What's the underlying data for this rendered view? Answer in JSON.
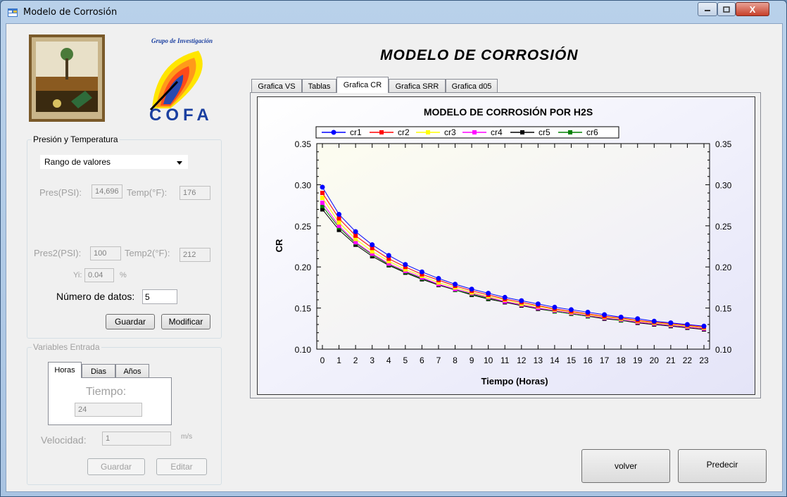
{
  "window": {
    "title": "Modelo de Corrosión",
    "close_glyph": "X"
  },
  "header": {
    "main_title": "MODELO DE CORROSIÓN",
    "logo_right_caption": "Grupo de Investigación",
    "logo_right_name": "COFA"
  },
  "presion_temperatura": {
    "group_title": "Presión y Temperatura",
    "combo_value": "Rango de valores",
    "pres_label": "Pres(PSI):",
    "pres_value": "14,696",
    "temp_label": "Temp(°F):",
    "temp_value": "176",
    "pres2_label": "Pres2(PSI):",
    "pres2_value": "100",
    "temp2_label": "Temp2(°F):",
    "temp2_value": "212",
    "yi_label": "Yi:",
    "yi_value": "0.04",
    "yi_unit": "%",
    "num_datos_label": "Número de datos:",
    "num_datos_value": "5",
    "guardar_label": "Guardar",
    "modificar_label": "Modificar"
  },
  "variables_entrada": {
    "group_title": "Variables Entrada",
    "tabs": [
      "Horas",
      "Dias",
      "Años"
    ],
    "tiempo_label": "Tiempo:",
    "tiempo_value": "24",
    "velocidad_label": "Velocidad:",
    "velocidad_value": "1",
    "velocidad_unit": "m/s",
    "guardar_label": "Guardar",
    "editar_label": "Editar"
  },
  "chart_tabs": [
    "Grafica VS",
    "Tablas",
    "Grafica CR",
    "Grafica SRR",
    "Grafica d05"
  ],
  "chart_tabs_active": "Grafica CR",
  "buttons": {
    "volver": "volver",
    "predecir": "Predecir"
  },
  "chart_data": {
    "type": "line",
    "title": "MODELO DE CORROSIÓN POR H2S",
    "xlabel": "Tiempo (Horas)",
    "ylabel": "CR",
    "x": [
      0,
      1,
      2,
      3,
      4,
      5,
      6,
      7,
      8,
      9,
      10,
      11,
      12,
      13,
      14,
      15,
      16,
      17,
      18,
      19,
      20,
      21,
      22,
      23
    ],
    "xlim": [
      0,
      23
    ],
    "ylim": [
      0.1,
      0.35
    ],
    "yticks": [
      "0.10",
      "0.15",
      "0.20",
      "0.25",
      "0.30",
      "0.35"
    ],
    "legend_position": "top",
    "grid": false,
    "series": [
      {
        "name": "cr1",
        "color": "#0000ff",
        "values": [
          0.297,
          0.264,
          0.243,
          0.227,
          0.214,
          0.203,
          0.194,
          0.186,
          0.179,
          0.173,
          0.168,
          0.163,
          0.159,
          0.155,
          0.151,
          0.148,
          0.145,
          0.142,
          0.139,
          0.137,
          0.134,
          0.132,
          0.13,
          0.128
        ]
      },
      {
        "name": "cr2",
        "color": "#ff0000",
        "values": [
          0.29,
          0.259,
          0.238,
          0.223,
          0.21,
          0.2,
          0.191,
          0.184,
          0.177,
          0.171,
          0.166,
          0.161,
          0.157,
          0.153,
          0.149,
          0.146,
          0.143,
          0.14,
          0.138,
          0.135,
          0.133,
          0.131,
          0.129,
          0.127
        ]
      },
      {
        "name": "cr3",
        "color": "#ffff00",
        "values": [
          0.284,
          0.254,
          0.234,
          0.219,
          0.207,
          0.197,
          0.189,
          0.181,
          0.175,
          0.169,
          0.164,
          0.16,
          0.155,
          0.152,
          0.148,
          0.145,
          0.142,
          0.139,
          0.137,
          0.134,
          0.132,
          0.13,
          0.128,
          0.126
        ]
      },
      {
        "name": "cr4",
        "color": "#ff00ff",
        "values": [
          0.278,
          0.25,
          0.23,
          0.216,
          0.204,
          0.195,
          0.187,
          0.179,
          0.173,
          0.168,
          0.163,
          0.158,
          0.154,
          0.15,
          0.147,
          0.144,
          0.141,
          0.138,
          0.136,
          0.133,
          0.131,
          0.129,
          0.127,
          0.125
        ]
      },
      {
        "name": "cr5",
        "color": "#000000",
        "values": [
          0.27,
          0.245,
          0.227,
          0.213,
          0.202,
          0.193,
          0.185,
          0.178,
          0.172,
          0.166,
          0.161,
          0.157,
          0.153,
          0.149,
          0.146,
          0.143,
          0.14,
          0.137,
          0.135,
          0.132,
          0.13,
          0.128,
          0.126,
          0.124
        ]
      },
      {
        "name": "cr6",
        "color": "#008000",
        "values": [
          0.274,
          0.248,
          0.229,
          0.215,
          0.203,
          0.194,
          0.186,
          0.179,
          0.172,
          0.167,
          0.162,
          0.158,
          0.154,
          0.15,
          0.146,
          0.143,
          0.14,
          0.138,
          0.135,
          0.133,
          0.131,
          0.129,
          0.127,
          0.125
        ]
      }
    ]
  }
}
